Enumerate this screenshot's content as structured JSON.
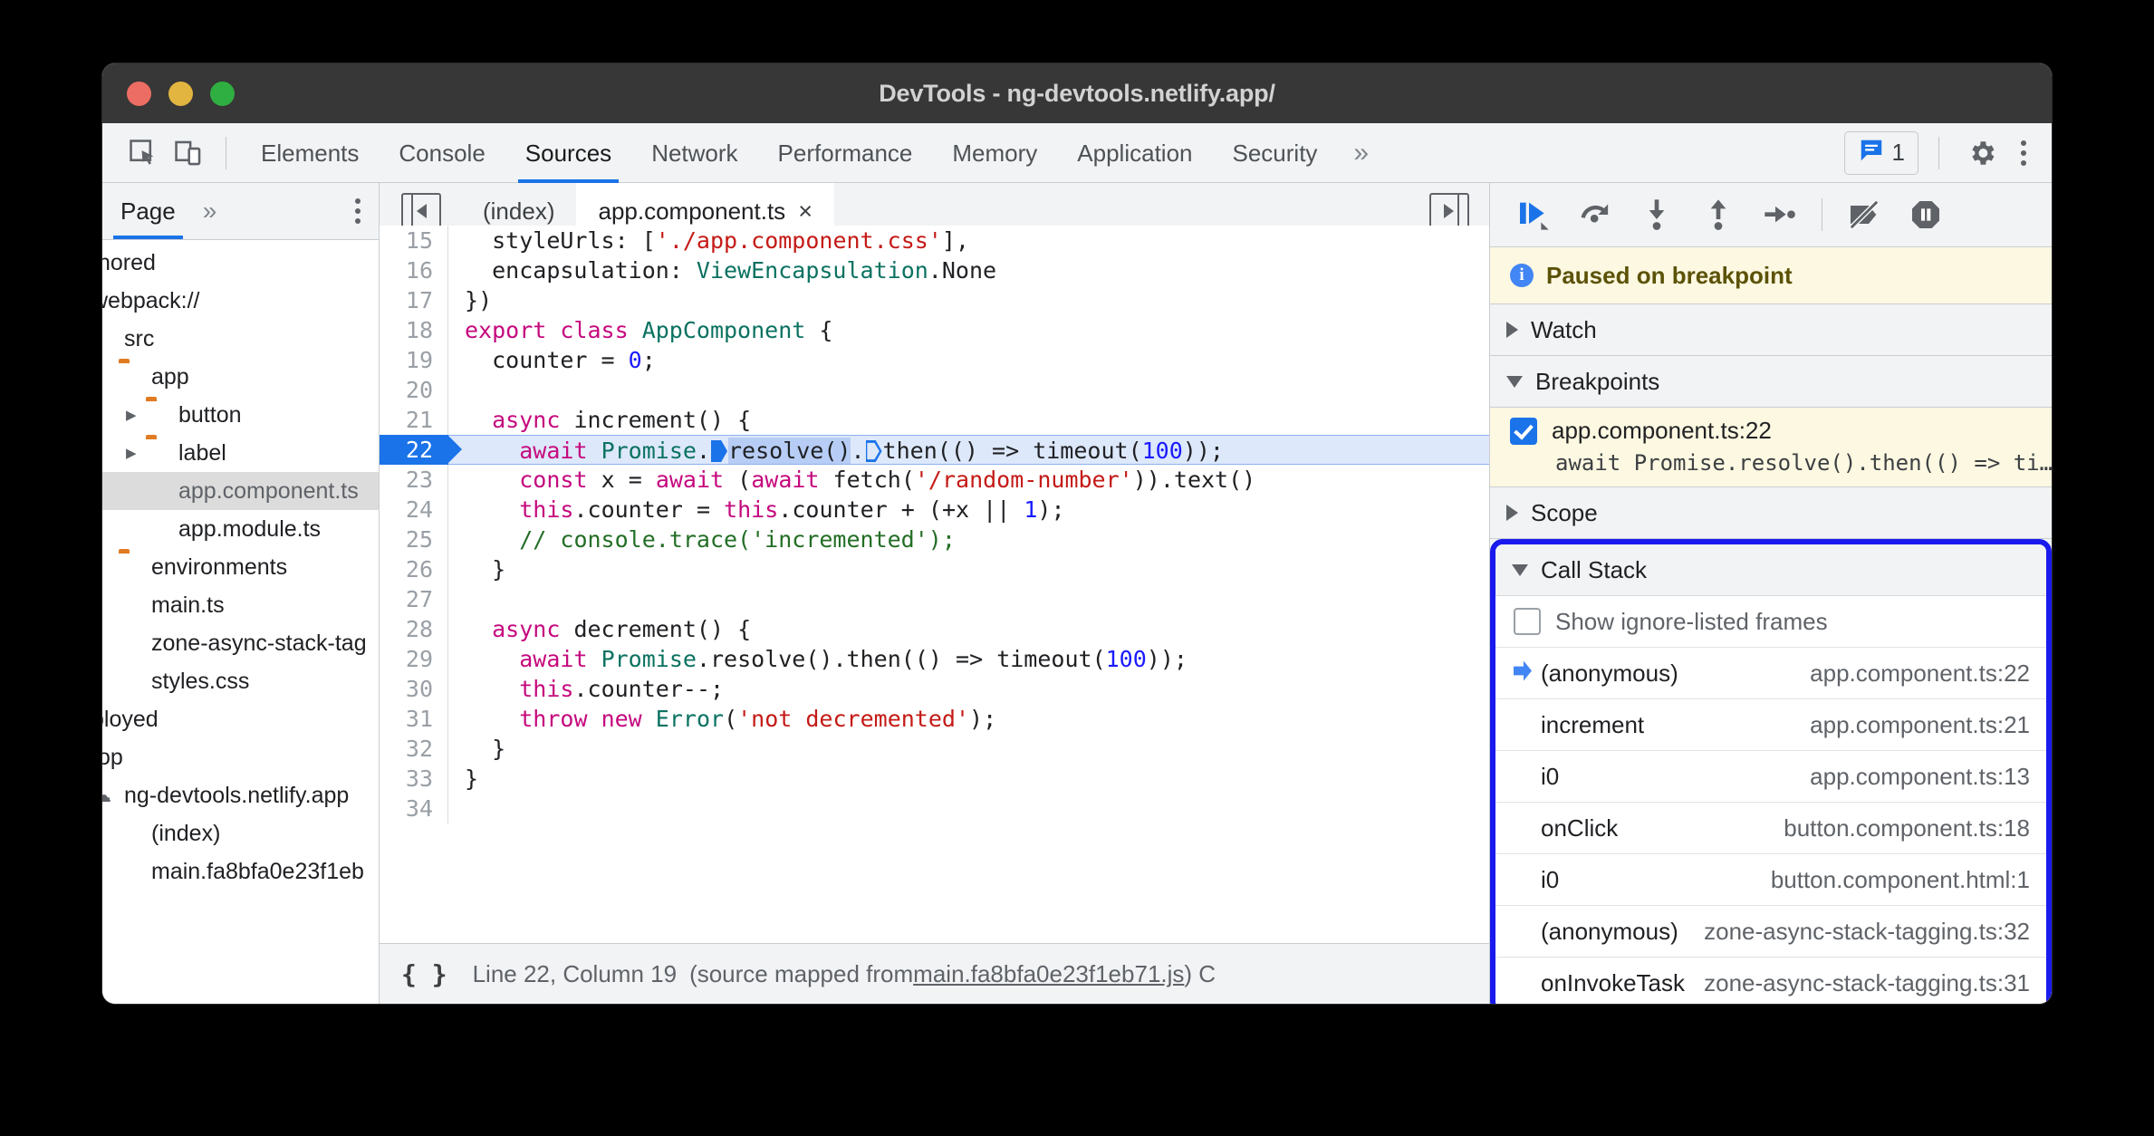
{
  "window": {
    "title": "DevTools - ng-devtools.netlify.app/",
    "traffic_lights": [
      "close-red",
      "minimize-yellow",
      "maximize-green"
    ]
  },
  "main_tabs": {
    "inspect_icon": "inspect-element-icon",
    "device_icon": "device-toolbar-icon",
    "items": [
      {
        "label": "Elements",
        "active": false
      },
      {
        "label": "Console",
        "active": false
      },
      {
        "label": "Sources",
        "active": true
      },
      {
        "label": "Network",
        "active": false
      },
      {
        "label": "Performance",
        "active": false
      },
      {
        "label": "Memory",
        "active": false
      },
      {
        "label": "Application",
        "active": false
      },
      {
        "label": "Security",
        "active": false
      }
    ],
    "more": "»",
    "issues_count": "1",
    "issues_icon": "issues-message-icon",
    "settings_icon": "gear-icon",
    "menu_icon": "kebab-menu-icon"
  },
  "navigator": {
    "tab_label": "Page",
    "more": "»",
    "menu_icon": "kebab-menu-icon",
    "tree": [
      {
        "label": "thored",
        "icon": "none",
        "indent": 0,
        "arrow": "",
        "selected": false
      },
      {
        "label": "webpack://",
        "icon": "none",
        "indent": 0,
        "arrow": "",
        "selected": false
      },
      {
        "label": "src",
        "icon": "folder",
        "indent": 0,
        "arrow": "",
        "selected": false
      },
      {
        "label": "app",
        "icon": "folder",
        "indent": 1,
        "arrow": "",
        "selected": false
      },
      {
        "label": "button",
        "icon": "folder",
        "indent": 2,
        "arrow": "right",
        "selected": false
      },
      {
        "label": "label",
        "icon": "folder",
        "indent": 2,
        "arrow": "right",
        "selected": false
      },
      {
        "label": "app.component.ts",
        "icon": "file-ts",
        "indent": 2,
        "arrow": "",
        "selected": true
      },
      {
        "label": "app.module.ts",
        "icon": "file-ts",
        "indent": 2,
        "arrow": "",
        "selected": false
      },
      {
        "label": "environments",
        "icon": "folder",
        "indent": 1,
        "arrow": "",
        "selected": false
      },
      {
        "label": "main.ts",
        "icon": "file-ts",
        "indent": 1,
        "arrow": "",
        "selected": false
      },
      {
        "label": "zone-async-stack-tag",
        "icon": "file-ts",
        "indent": 1,
        "arrow": "",
        "selected": false
      },
      {
        "label": "styles.css",
        "icon": "file-css",
        "indent": 1,
        "arrow": "",
        "selected": false
      },
      {
        "label": "ployed",
        "icon": "none",
        "indent": 0,
        "arrow": "",
        "selected": false
      },
      {
        "label": "top",
        "icon": "none",
        "indent": 0,
        "arrow": "",
        "selected": false
      },
      {
        "label": "ng-devtools.netlify.app",
        "icon": "cloud",
        "indent": 0,
        "arrow": "",
        "selected": false
      },
      {
        "label": "(index)",
        "icon": "file-grey",
        "indent": 1,
        "arrow": "",
        "selected": false
      },
      {
        "label": "main.fa8bfa0e23f1eb",
        "icon": "file-ts",
        "indent": 1,
        "arrow": "",
        "selected": false
      }
    ]
  },
  "editor": {
    "panel_toggle_icon": "show-navigator-icon",
    "popout_icon": "show-debugger-icon",
    "tabs": [
      {
        "label": "(index)",
        "active": false,
        "closable": false
      },
      {
        "label": "app.component.ts",
        "active": true,
        "closable": true,
        "close": "×"
      }
    ],
    "lines": [
      {
        "n": "15",
        "state": "clipped"
      },
      {
        "n": "16",
        "state": "normal"
      },
      {
        "n": "17",
        "state": "normal"
      },
      {
        "n": "18",
        "state": "normal"
      },
      {
        "n": "19",
        "state": "normal"
      },
      {
        "n": "20",
        "state": "normal"
      },
      {
        "n": "21",
        "state": "normal"
      },
      {
        "n": "22",
        "state": "current"
      },
      {
        "n": "23",
        "state": "normal"
      },
      {
        "n": "24",
        "state": "normal"
      },
      {
        "n": "25",
        "state": "normal"
      },
      {
        "n": "26",
        "state": "normal"
      },
      {
        "n": "27",
        "state": "normal"
      },
      {
        "n": "28",
        "state": "normal"
      },
      {
        "n": "29",
        "state": "normal"
      },
      {
        "n": "30",
        "state": "normal"
      },
      {
        "n": "31",
        "state": "normal"
      },
      {
        "n": "32",
        "state": "normal"
      },
      {
        "n": "33",
        "state": "normal"
      },
      {
        "n": "34",
        "state": "normal"
      }
    ],
    "source_text": [
      "  styleUrls: ['./app.component.css'],",
      "  encapsulation: ViewEncapsulation.None",
      "})",
      "export class AppComponent {",
      "  counter = 0;",
      "",
      "  async increment() {",
      "    await Promise.resolve().then(() => timeout(100));",
      "    const x = await (await fetch('/random-number')).text()",
      "    this.counter = this.counter + (+x || 1);",
      "    // console.trace('incremented');",
      "  }",
      "",
      "  async decrement() {",
      "    await Promise.resolve().then(() => timeout(100));",
      "    this.counter--;",
      "    throw new Error('not decremented');",
      "  }",
      "}",
      ""
    ]
  },
  "status_bar": {
    "pretty_print_icon": "{ }",
    "position": "Line 22, Column 19",
    "source_map_prefix": "(source mapped from ",
    "source_map_file": "main.fa8bfa0e23f1eb71.js",
    "source_map_suffix": ") C"
  },
  "debugger": {
    "toolbar": [
      {
        "name": "resume-script-execution",
        "glyph": "resume"
      },
      {
        "name": "step-over-next-function-call",
        "glyph": "step-over"
      },
      {
        "name": "step-into-next-function-call",
        "glyph": "step-into"
      },
      {
        "name": "step-out-of-current-function",
        "glyph": "step-out"
      },
      {
        "name": "step",
        "glyph": "step"
      },
      {
        "name": "deactivate-breakpoints",
        "glyph": "deactivate-breakpoints"
      },
      {
        "name": "pause-on-exceptions",
        "glyph": "pause-on-exceptions"
      }
    ],
    "paused_banner": {
      "icon": "info-icon",
      "text": "Paused on breakpoint"
    },
    "watch": {
      "label": "Watch",
      "expanded": false
    },
    "breakpoints": {
      "label": "Breakpoints",
      "expanded": true,
      "items": [
        {
          "checked": true,
          "location": "app.component.ts:22",
          "snippet": "await Promise.resolve().then(() => ti…"
        }
      ]
    },
    "scope": {
      "label": "Scope",
      "expanded": false
    },
    "call_stack": {
      "label": "Call Stack",
      "expanded": true,
      "highlighted": true,
      "highlight_color": "#1a1aee",
      "show_ignore_listed": {
        "label": "Show ignore-listed frames",
        "checked": false
      },
      "frames": [
        {
          "name": "(anonymous)",
          "location": "app.component.ts:22",
          "selected": true
        },
        {
          "name": "increment",
          "location": "app.component.ts:21",
          "selected": false
        },
        {
          "name": "i0",
          "location": "app.component.ts:13",
          "selected": false
        },
        {
          "name": "onClick",
          "location": "button.component.ts:18",
          "selected": false
        },
        {
          "name": "i0",
          "location": "button.component.html:1",
          "selected": false
        },
        {
          "name": "(anonymous)",
          "location": "zone-async-stack-tagging.ts:32",
          "selected": false
        },
        {
          "name": "onInvokeTask",
          "location": "zone-async-stack-tagging.ts:31",
          "selected": false
        }
      ]
    }
  }
}
